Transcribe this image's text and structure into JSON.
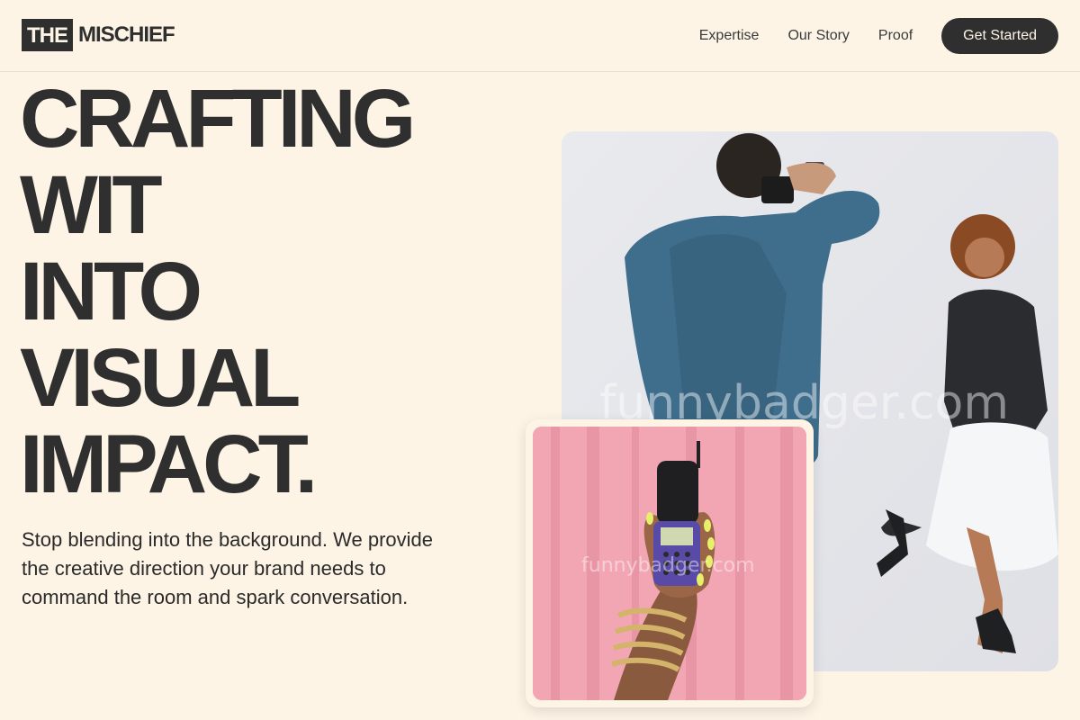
{
  "header": {
    "logo_box": "THE",
    "logo_text": "MISCHIEF",
    "nav": [
      "Expertise",
      "Our Story",
      "Proof"
    ],
    "cta_label": "Get Started"
  },
  "hero": {
    "headline_lines": [
      "CRAFTING",
      "WIT",
      "INTO",
      "VISUAL",
      "IMPACT."
    ],
    "subtext": "Stop blending into the background. We provide the creative direction your brand needs to command the room and spark conversation."
  },
  "images": {
    "main_photo": {
      "description_name": "photographer-shooting-dancing-woman-photo",
      "watermark": "funnybadger.com"
    },
    "small_photo": {
      "description_name": "hand-holding-retro-flip-phone-photo",
      "watermark": "funnybadger.com"
    }
  },
  "colors": {
    "background": "#fdf4e6",
    "ink": "#2f2f2f",
    "pink": "#f2a6b4"
  }
}
